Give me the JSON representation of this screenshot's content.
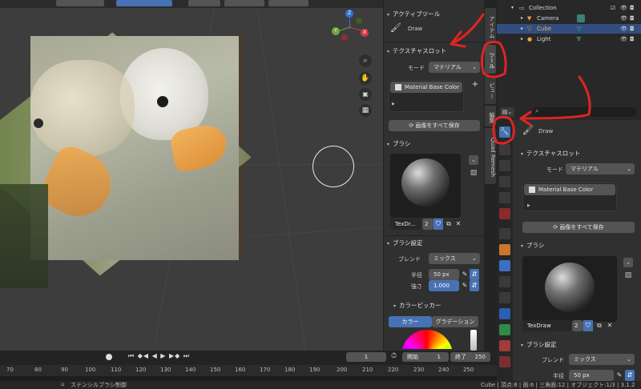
{
  "npanel": {
    "active_tool_header": "アクティブツール",
    "active_tool_name": "Draw",
    "texture_slot_header": "テクスチャスロット",
    "mode_label": "モード",
    "mode_value": "マテリアル",
    "slot_item": "Material Base Color",
    "save_all_button": "画像をすべて保存",
    "brush_header": "ブラシ",
    "brush_name": "TexDr...",
    "brush_users": "2",
    "brush_settings_header": "ブラシ設定",
    "blend_label": "ブレンド",
    "blend_value": "ミックス",
    "radius_label": "半径",
    "radius_value": "50 px",
    "strength_label": "強さ",
    "strength_value": "1.000",
    "color_picker_header": "カラーピッカー",
    "tab_color": "カラー",
    "tab_gradient": "グラデーション"
  },
  "vtabs": {
    "item": "アイテム",
    "tool": "ツール",
    "view": "ビュー",
    "edit": "編集",
    "quad": "Quad Remesh"
  },
  "outliner": {
    "collection": "Collection",
    "rows": [
      "Camera",
      "Cube",
      "Light"
    ]
  },
  "props": {
    "tool_name": "Draw",
    "texture_slot_header": "テクスチャスロット",
    "mode_label": "モード",
    "mode_value": "マテリアル",
    "slot_item": "Material Base Color",
    "save_all_button": "画像をすべて保存",
    "brush_header": "ブラシ",
    "brush_name": "TexDraw",
    "brush_users": "2",
    "brush_settings_header": "ブラシ設定",
    "blend_label": "ブレンド",
    "blend_value": "ミックス",
    "radius_label": "半径",
    "radius_value": "50 px"
  },
  "timeline": {
    "current_frame": "1",
    "start_label": "開始",
    "start_value": "1",
    "end_label": "終了",
    "end_value": "250",
    "ruler": [
      "70",
      "80",
      "90",
      "100",
      "110",
      "120",
      "130",
      "140",
      "150",
      "160",
      "170",
      "180",
      "190",
      "200",
      "210",
      "220",
      "230",
      "240",
      "250"
    ]
  },
  "status": {
    "left": "ステンシルブラシ制御",
    "right": "Cube | 頂点:8 | 面:6 | 三角面:12 | オブジェクト:1/3 | 3.1.2"
  },
  "gizmo_labels": {
    "z": "Z",
    "y": "Y",
    "x": "X"
  }
}
